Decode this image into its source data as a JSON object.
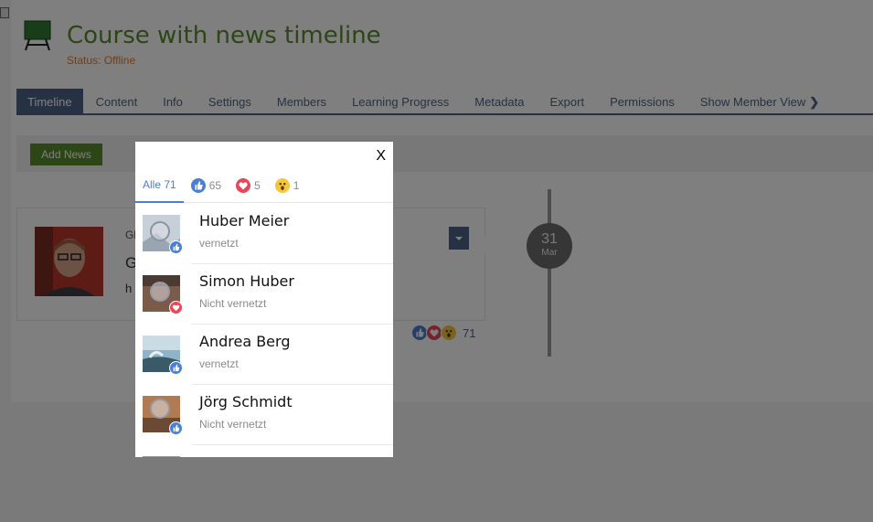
{
  "course": {
    "title": "Course with news timeline",
    "status": "Status: Offline"
  },
  "tabs": [
    {
      "label": "Timeline",
      "active": true
    },
    {
      "label": "Content"
    },
    {
      "label": "Info"
    },
    {
      "label": "Settings"
    },
    {
      "label": "Members"
    },
    {
      "label": "Learning Progress"
    },
    {
      "label": "Metadata"
    },
    {
      "label": "Export"
    },
    {
      "label": "Permissions"
    },
    {
      "label": "Show Member View"
    }
  ],
  "toolbar": {
    "add_news_label": "Add News"
  },
  "news": {
    "line1": "Gl",
    "line2": "G",
    "line3": "h",
    "reaction_count": "71",
    "reaction_icons": [
      "like-icon",
      "love-icon",
      "wow-icon"
    ]
  },
  "timeline": {
    "day": "31",
    "month": "Mar"
  },
  "modal": {
    "close_label": "X",
    "filters": [
      {
        "label": "Alle 71",
        "active": true
      },
      {
        "icon": "like-icon",
        "count": "65"
      },
      {
        "icon": "love-icon",
        "count": "5"
      },
      {
        "icon": "wow-icon",
        "count": "1"
      }
    ],
    "people": [
      {
        "name": "Huber Meier",
        "status": "vernetzt",
        "reaction": "like-icon"
      },
      {
        "name": "Simon Huber",
        "status": "Nicht vernetzt",
        "reaction": "love-icon"
      },
      {
        "name": "Andrea Berg",
        "status": "vernetzt",
        "reaction": "like-icon"
      },
      {
        "name": "Jörg Schmidt",
        "status": "Nicht vernetzt",
        "reaction": "like-icon"
      }
    ]
  },
  "colors": {
    "brand_green": "#5a8c2b",
    "tab_blue": "#4c6586",
    "status_orange": "#e57b2a",
    "like_blue": "#4a7fd6",
    "love_red": "#e8475b",
    "wow_yellow": "#f5c63c"
  }
}
